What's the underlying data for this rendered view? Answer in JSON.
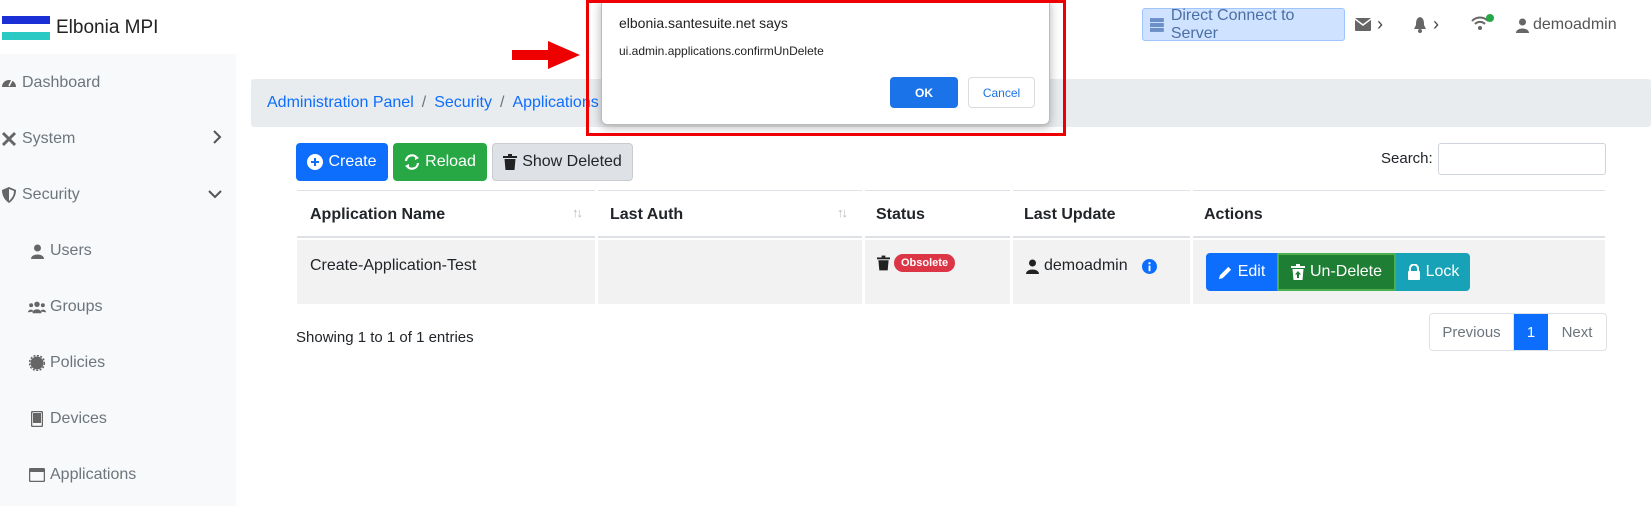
{
  "header": {
    "brand": "Elbonia MPI",
    "flag_colors": [
      "#1a2fd6",
      "#ffffff",
      "#2bc9c4"
    ],
    "direct_connect_label": "Direct Connect to Server",
    "user": "demoadmin",
    "icons": [
      "server-icon",
      "envelope-icon",
      "bell-icon",
      "wifi-icon",
      "user-icon"
    ],
    "wifi_status_color": "#28a745"
  },
  "sidebar": {
    "items": [
      {
        "label": "Dashboard",
        "icon": "dashboard-icon"
      },
      {
        "label": "System",
        "icon": "tools-icon",
        "chevron": "right"
      },
      {
        "label": "Security",
        "icon": "shield-icon",
        "chevron": "down"
      },
      {
        "label": "Users",
        "icon": "user-icon"
      },
      {
        "label": "Groups",
        "icon": "users-icon"
      },
      {
        "label": "Policies",
        "icon": "certificate-icon"
      },
      {
        "label": "Devices",
        "icon": "tablet-icon"
      },
      {
        "label": "Applications",
        "icon": "window-icon"
      }
    ]
  },
  "breadcrumb": {
    "items": [
      "Administration Panel",
      "Security",
      "Applications"
    ],
    "separator": "/"
  },
  "toolbar": {
    "create_label": "Create",
    "reload_label": "Reload",
    "show_deleted_label": "Show Deleted",
    "search_label": "Search:",
    "search_value": ""
  },
  "table": {
    "columns": [
      "Application Name",
      "Last Auth",
      "Status",
      "Last Update",
      "Actions"
    ],
    "rows": [
      {
        "name": "Create-Application-Test",
        "last_auth": "",
        "status": "Obsolete",
        "last_update_user": "demoadmin"
      }
    ],
    "actions": {
      "edit": "Edit",
      "undelete": "Un-Delete",
      "lock": "Lock"
    }
  },
  "footer": {
    "info": "Showing 1 to 1 of 1 entries",
    "previous": "Previous",
    "page": "1",
    "next": "Next"
  },
  "dialog": {
    "title": "elbonia.santesuite.net says",
    "message": "ui.admin.applications.confirmUnDelete",
    "ok": "OK",
    "cancel": "Cancel",
    "highlight_color": "#ee0000"
  }
}
